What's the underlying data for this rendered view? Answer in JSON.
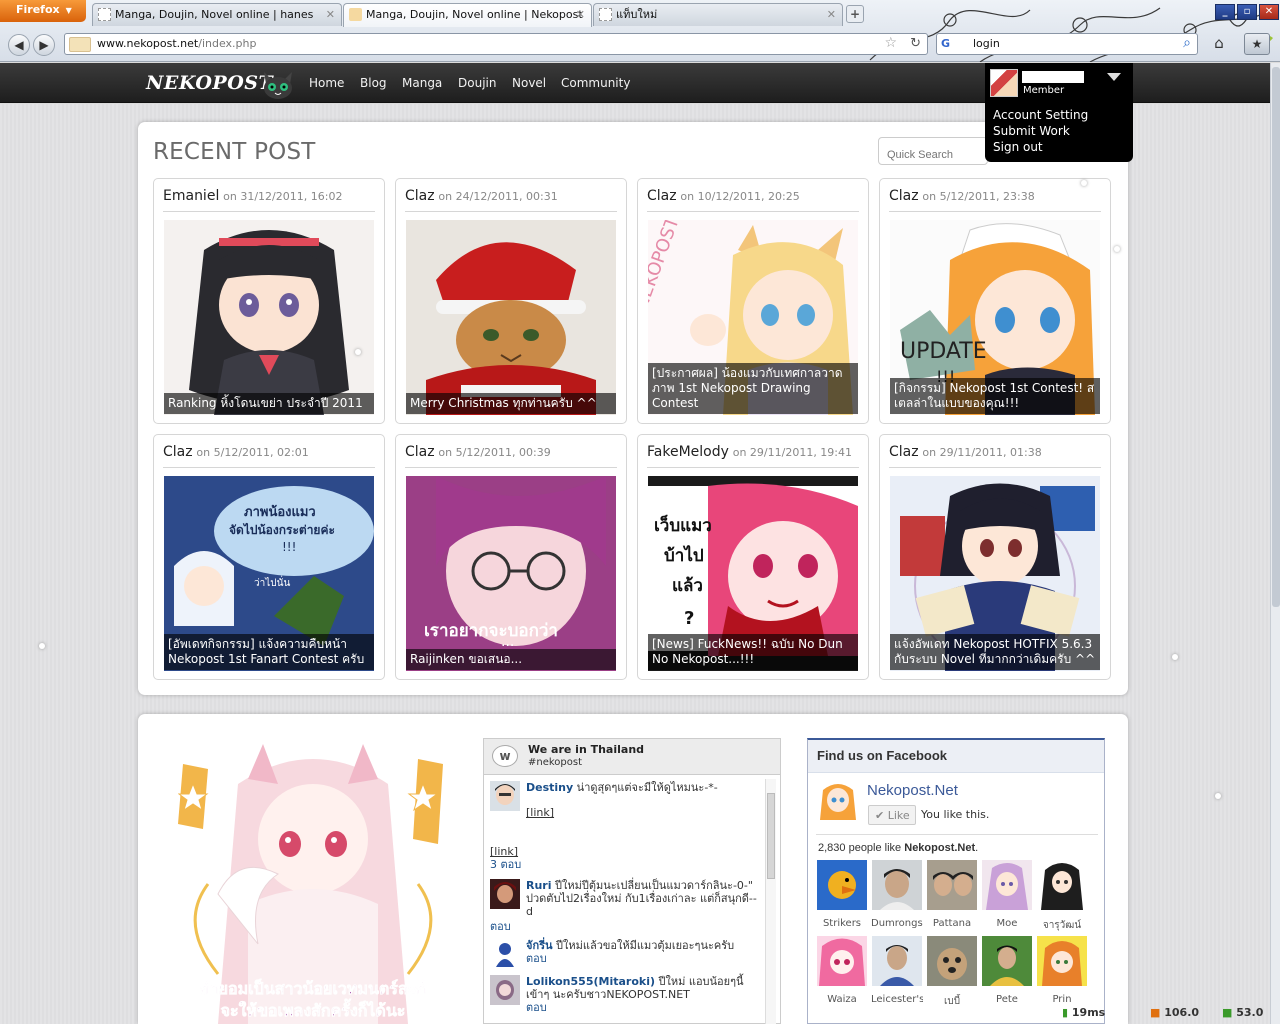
{
  "browser": {
    "app_button": "Firefox",
    "tabs": [
      {
        "title": "Manga, Doujin, Novel online | hanes",
        "active": false
      },
      {
        "title": "Manga, Doujin, Novel online | Nekopost",
        "active": true
      },
      {
        "title": "แท็บใหม่",
        "active": false
      }
    ],
    "url_domain": "www.nekopost.net",
    "url_path": "/index.php",
    "search_value": "login",
    "window_buttons": [
      "_",
      "▫",
      "✕"
    ]
  },
  "site": {
    "logo": "NEKOPOST",
    "nav": [
      "Home",
      "Blog",
      "Manga",
      "Doujin",
      "Novel",
      "Community"
    ],
    "user": {
      "role": "Member",
      "menu": [
        "Account Setting",
        "Submit Work",
        "Sign out"
      ]
    }
  },
  "recent": {
    "title": "RECENT POST",
    "search_placeholder": "Quick Search",
    "posts": [
      {
        "author": "Emaniel",
        "meta": "on 31/12/2011, 16:02",
        "caption": "Ranking หิ้งโดนเขย่า ประจำปี 2011"
      },
      {
        "author": "Claz",
        "meta": "on 24/12/2011, 00:31",
        "caption": "Merry Christmas ทุกท่านครับ ^^"
      },
      {
        "author": "Claz",
        "meta": "on 10/12/2011, 20:25",
        "caption": "[ประกาศผล] น้องแมวกับเทศกาลวาดภาพ 1st Nekopost Drawing Contest"
      },
      {
        "author": "Claz",
        "meta": "on 5/12/2011, 23:38",
        "caption": "[กิจกรรม] Nekopost 1st Contest! สเตลล่าในแบบของคุณ!!!"
      },
      {
        "author": "Claz",
        "meta": "on 5/12/2011, 02:01",
        "caption": "[อัพเดทกิจกรรม] แจ้งความคืบหน้า Nekopost 1st Fanart Contest ครับ"
      },
      {
        "author": "Claz",
        "meta": "on 5/12/2011, 00:39",
        "caption": "Raijinken ขอเสนอ..."
      },
      {
        "author": "FakeMelody",
        "meta": "on 29/11/2011, 19:41",
        "caption": "[News] FuckNews!! ฉบับ No Dun No Nekopost...!!!"
      },
      {
        "author": "Claz",
        "meta": "on 29/11/2011, 01:38",
        "caption": "แจ้งอัพเดท Nekopost HOTFIX 5.6.3 กับระบบ Novel ที่มากกว่าเดิมครับ ^^"
      }
    ],
    "thumb_texts": {
      "update": "UPDATE",
      "update2": "!!!",
      "neko_vertical": "NEKOPOST",
      "cat_bubble1": "ภาพน้องแมว",
      "cat_bubble2": "จัดไปน้องกระต่ายค่ะ",
      "cat_bubble3": "!!!",
      "cat_bubble4": "ว่าไปนั่น",
      "glasses_text": "เราอยากจะบอกว่า",
      "glasses_dots": "...",
      "blood_text1": "เว็บแมว",
      "blood_text2": "บ้าไป",
      "blood_text3": "แล้ว",
      "blood_text4": "?"
    }
  },
  "lower": {
    "anime_banner_line1": "ถ้ายอมเป็นสาวน้อยเวทมนตร์ละก็",
    "anime_banner_line2": "จะให้ขอเพลงสักครั้งก็ได้นะ",
    "twitter": {
      "title": "We are in Thailand",
      "hashtag": "#nekopost",
      "logo": "w",
      "items": [
        {
          "name": "Destiny",
          "text": "น่าดูสุดๆแต่จะมีให้ดูไหมนะ-*-",
          "link": "[link]"
        },
        {
          "link": "[link]",
          "reply": "3 ตอบ"
        },
        {
          "name": "Ruri",
          "text": "ปีใหม่ปีตุ้มนะเปลี่ยนเป็นแมวดาร์กลินะ-0-\" ปวดตับไป2เรื่องใหม่ กับ1เรื่องเก่าละ แต่ก็สนุกดี--d",
          "reply": "ตอบ"
        },
        {
          "name": "จักรี่น",
          "text": "ปีใหม่แล้วขอให้มีแมวตุ้มเยอะๆนะครับ",
          "reply": "ตอบ"
        },
        {
          "name": "Lolikon555(Mitaroki)",
          "text": "ปีใหม่ แอบน้อยๆนี้เข้าๆ นะครับชาวNEKOPOST.NET",
          "reply": "ตอบ"
        }
      ]
    },
    "facebook": {
      "header": "Find us on Facebook",
      "page_name": "Nekopost.Net",
      "like_button": "Like",
      "you_like": "You like this.",
      "count_prefix": "2,830 people like",
      "count_page": "Nekopost.Net",
      "fans": [
        "Strikers",
        "Dumrongsa",
        "Pattana",
        "Moe",
        "จารุวัฒน์",
        "Waiza",
        "Leicester's",
        "เบบี้",
        "Pete",
        "Prin"
      ]
    }
  },
  "status": {
    "latency": "19ms",
    "val1": "106.0",
    "val2": "53.0"
  }
}
